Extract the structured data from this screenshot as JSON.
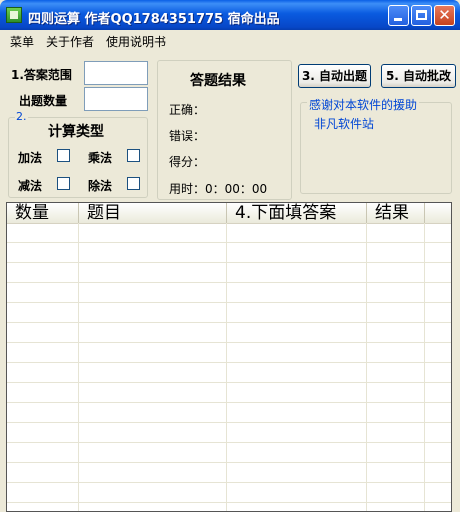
{
  "window": {
    "title": "四则运算 作者QQ1784351775 宿命出品"
  },
  "menu": {
    "items": [
      "菜单",
      "关于作者",
      "使用说明书"
    ]
  },
  "settings": {
    "answer_range_label": "1.答案范围",
    "question_count_label": "出题数量",
    "calc_group_number": "2.",
    "calc_group_title": "计算类型",
    "add_label": "加法",
    "multiply_label": "乘法",
    "subtract_label": "减法",
    "divide_label": "除法"
  },
  "results": {
    "title": "答题结果",
    "correct_label": "正确：",
    "wrong_label": "错误：",
    "score_label": "得分：",
    "time_label": "用时：",
    "time_value": "0：00：00"
  },
  "actions": {
    "auto_generate_label": "3. 自动出题",
    "auto_grade_label": "5. 自动批改",
    "thanks_text": "感谢对本软件的援助",
    "sponsor_text": "非凡软件站"
  },
  "grid": {
    "columns": [
      "数量",
      "题目",
      "4.下面填答案",
      "结果"
    ]
  },
  "colors": {
    "titlebar": "#0a5be0",
    "window_bg": "#ece9d8",
    "group_text": "#0046d5"
  }
}
